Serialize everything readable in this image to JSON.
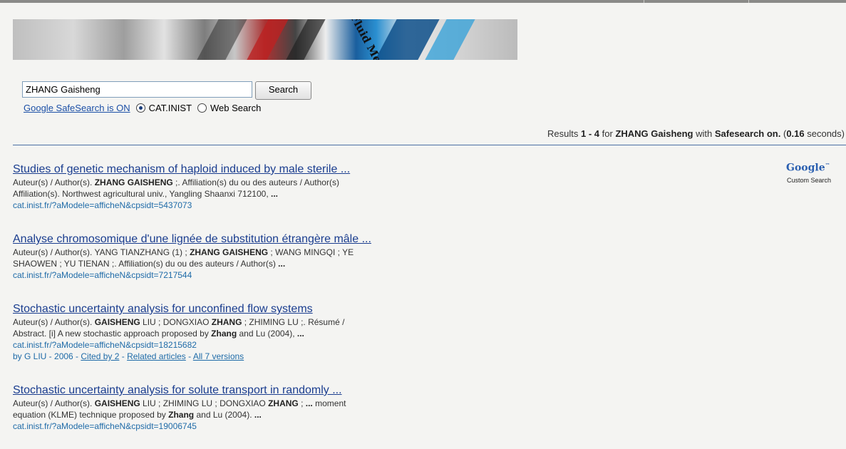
{
  "search": {
    "query": "ZHANG Gaisheng",
    "button_label": "Search",
    "safesearch_link": "Google SafeSearch is ON",
    "option_catinist": "CAT.INIST",
    "option_web": "Web Search",
    "selected_option": "CAT.INIST"
  },
  "summary": {
    "prefix": "Results ",
    "range": "1 - 4",
    "for_text": " for ",
    "query": "ZHANG Gaisheng",
    "with_text": " with ",
    "safesearch": "Safesearch on.",
    "time_open": " (",
    "time": "0.16",
    "time_close": " seconds)"
  },
  "branding": {
    "banner_text": "Fluid Me",
    "google": "Google",
    "tm": "™",
    "custom_search": "Custom Search"
  },
  "results": [
    {
      "title": "Studies of genetic mechanism of haploid induced by male sterile ...",
      "s1a": "Auteur(s) / Author(s). ",
      "s1b": "ZHANG GAISHENG",
      "s1c": " ;. Affiliation(s) du ou des auteurs / Author(s)",
      "s2a": "Affiliation(s). Northwest agricultural univ., Yangling Shaanxi 712100, ",
      "s2b": "...",
      "url": "cat.inist.fr/?aModele=afficheN&cpsidt=5437073"
    },
    {
      "title": "Analyse chromosomique d'une lignée de substitution étrangère mâle ...",
      "s1a": "Auteur(s) / Author(s). YANG TIANZHANG (1) ; ",
      "s1b": "ZHANG GAISHENG",
      "s1c": " ; WANG MINGQI ; YE",
      "s2a": "SHAOWEN ; YU TIENAN ;. Affiliation(s) du ou des auteurs / Author(s) ",
      "s2b": "...",
      "url": "cat.inist.fr/?aModele=afficheN&cpsidt=7217544"
    },
    {
      "title": "Stochastic uncertainty analysis for unconfined flow systems",
      "s1a": "Auteur(s) / Author(s). ",
      "s1b": "GAISHENG",
      "s1c": " LIU ; DONGXIAO ",
      "s1d": "ZHANG",
      "s1e": " ; ZHIMING LU ;. Résumé /",
      "s2a": "Abstract. [i] A new stochastic approach proposed by ",
      "s2b": "Zhang",
      "s2c": " and Lu (2004), ",
      "s2d": "...",
      "url": "cat.inist.fr/?aModele=afficheN&cpsidt=18215682",
      "meta_prefix": "by G LIU - 2006 - ",
      "cited_by": "Cited by 2",
      "related": "Related articles",
      "versions": "All 7 versions",
      "sep": " - "
    },
    {
      "title": "Stochastic uncertainty analysis for solute transport in randomly ...",
      "s1a": "Auteur(s) / Author(s). ",
      "s1b": "GAISHENG",
      "s1c": " LIU ; ZHIMING LU ; DONGXIAO ",
      "s1d": "ZHANG",
      "s1e": " ; ",
      "s1f": "...",
      "s1g": " moment",
      "s2a": "equation (KLME) technique proposed by ",
      "s2b": "Zhang",
      "s2c": " and Lu (2004). ",
      "s2d": "...",
      "url": "cat.inist.fr/?aModele=afficheN&cpsidt=19006745"
    }
  ]
}
